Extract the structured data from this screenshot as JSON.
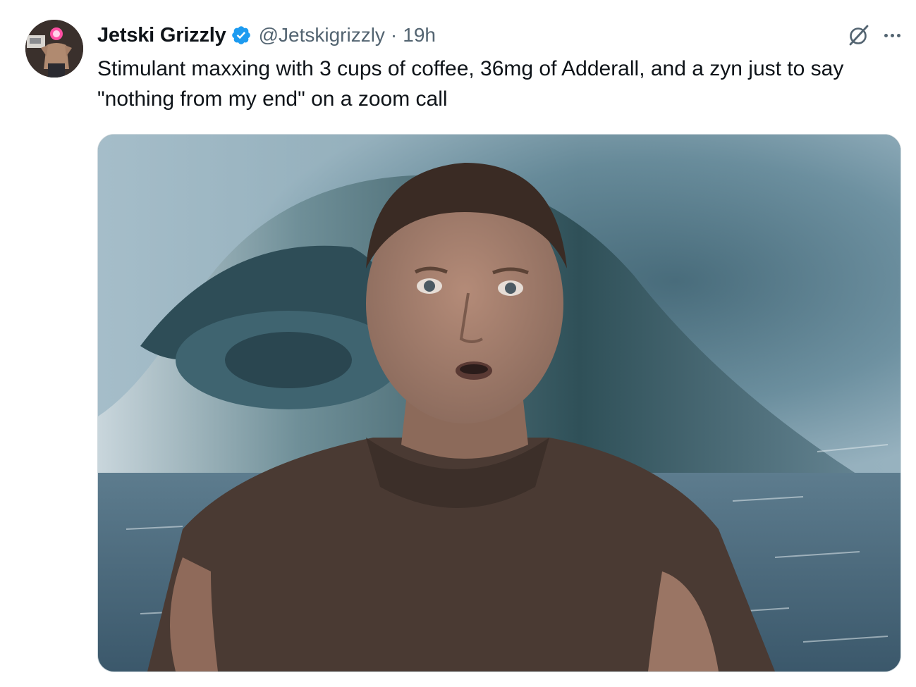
{
  "tweet": {
    "display_name": "Jetski Grizzly",
    "handle": "@Jetskigrizzly",
    "separator": "·",
    "time": "19h",
    "text": "Stimulant maxxing with 3 cups of coffee, 36mg of Adderall, and a zyn just to say \"nothing from my end\" on a zoom call",
    "verified": true
  },
  "icons": {
    "verified": "verified-badge-icon",
    "grok": "grok-icon",
    "more": "more-options-icon"
  },
  "colors": {
    "verified_blue": "#1d9bf0",
    "text_primary": "#0f1419",
    "text_secondary": "#536471",
    "border": "#cfd9de"
  }
}
